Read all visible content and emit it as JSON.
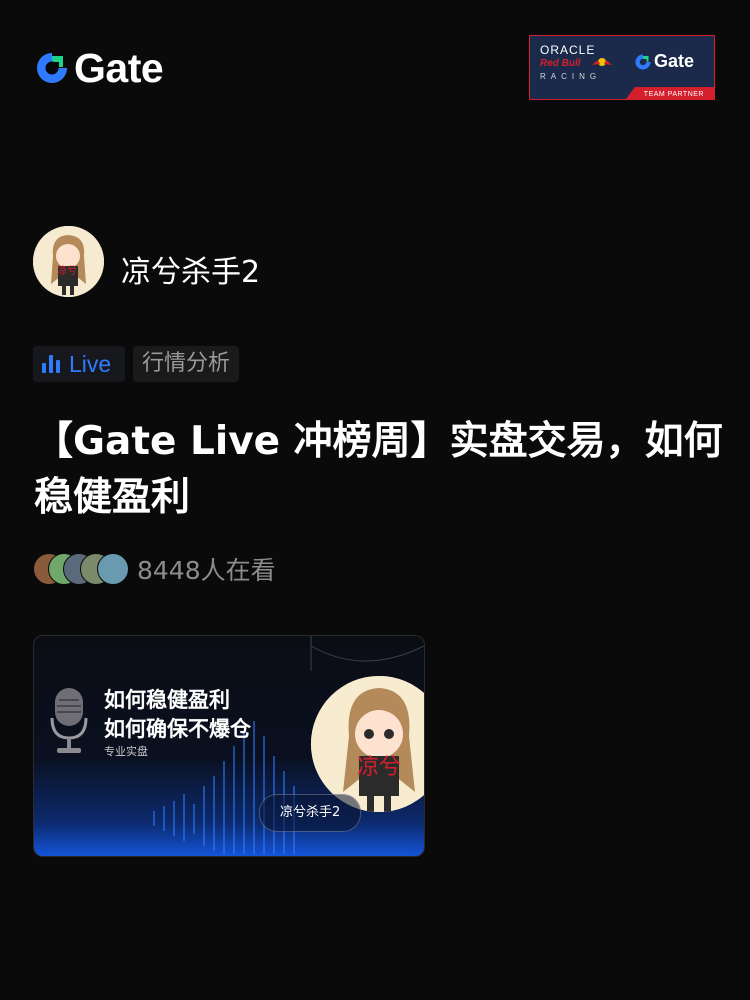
{
  "brand": {
    "logo_text": "Gate",
    "accent": "#2f7bff",
    "green": "#1ed48c"
  },
  "partner_badge": {
    "oracle": "ORACLE",
    "redbull": "Red Bull",
    "racing": "RACING",
    "gate": "Gate",
    "tagline": "TEAM PARTNER"
  },
  "author": {
    "name": "凉兮杀手2",
    "avatar_text": "凉兮"
  },
  "tags": {
    "live": "Live",
    "category": "行情分析"
  },
  "post": {
    "title": "【Gate Live 冲榜周】实盘交易，如何稳健盈利"
  },
  "viewers": {
    "count_text": "8448人在看",
    "avatar_count": 5
  },
  "stream_card": {
    "line1": "如何稳健盈利",
    "line2": "如何确保不爆仓",
    "subtitle": "专业实盘",
    "host_label": "凉兮杀手2",
    "host_avatar_text": "凉兮",
    "mic_icon": "microphone-icon"
  }
}
